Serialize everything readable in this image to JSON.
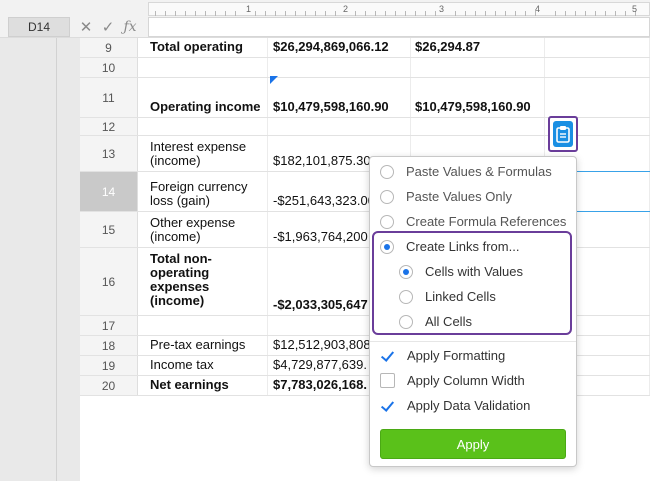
{
  "formula_bar": {
    "cell_ref": "D14",
    "cancel_icon": "✕",
    "confirm_icon": "✓",
    "fx_icon": "ƒx"
  },
  "ruler": {
    "numbers": [
      "1",
      "2",
      "3",
      "4",
      "5"
    ]
  },
  "rows": [
    {
      "num": "9",
      "label": "Total operating",
      "val1": "$26,294,869,066.12",
      "val2": "$26,294.87",
      "bold": true
    },
    {
      "num": "10",
      "label": "",
      "val1": "",
      "val2": ""
    },
    {
      "num": "11",
      "label": "Operating income",
      "val1": "$10,479,598,160.90",
      "val2": "$10,479,598,160.90",
      "bold": true
    },
    {
      "num": "12",
      "label": "",
      "val1": "",
      "val2": ""
    },
    {
      "num": "13",
      "label": "Interest expense (income)",
      "val1": "$182,101,875.30",
      "val2": ""
    },
    {
      "num": "14",
      "label": "Foreign currency loss (gain)",
      "val1": "-$251,643,323.00",
      "val2": "",
      "active": true
    },
    {
      "num": "15",
      "label": "Other expense (income)",
      "val1": "-$1,963,764,200",
      "val2": ""
    },
    {
      "num": "16",
      "label": "Total non-operating expenses (income)",
      "val1": "-$2,033,305,647",
      "val2": "",
      "bold": true
    },
    {
      "num": "17",
      "label": "",
      "val1": "",
      "val2": ""
    },
    {
      "num": "18",
      "label": "Pre-tax earnings",
      "val1": "$12,512,903,808",
      "val2": ""
    },
    {
      "num": "19",
      "label": "Income tax",
      "val1": "$4,729,877,639.",
      "val2": ""
    },
    {
      "num": "20",
      "label": "Net earnings",
      "val1": "$7,783,026,168.",
      "val2": "",
      "bold": true
    }
  ],
  "paste_menu": {
    "options": [
      {
        "label": "Paste Values & Formulas",
        "type": "radio",
        "selected": false
      },
      {
        "label": "Paste Values Only",
        "type": "radio",
        "selected": false
      },
      {
        "label": "Create Formula References",
        "type": "radio",
        "selected": false
      },
      {
        "label": "Create Links from...",
        "type": "radio",
        "selected": true
      },
      {
        "label": "Cells with Values",
        "type": "radio",
        "selected": true
      },
      {
        "label": "Linked Cells",
        "type": "radio",
        "selected": false
      },
      {
        "label": "All Cells",
        "type": "radio",
        "selected": false
      }
    ],
    "checkboxes": [
      {
        "label": "Apply Formatting",
        "checked": true
      },
      {
        "label": "Apply Column Width",
        "checked": false
      },
      {
        "label": "Apply Data Validation",
        "checked": true
      }
    ],
    "apply_label": "Apply"
  },
  "icons": {
    "paste_options": "clipboard-icon"
  },
  "colors": {
    "accent_blue": "#1a73e8",
    "highlight_purple": "#6a3d9a",
    "apply_green": "#5ac11a",
    "paste_blue": "#1a8fe3"
  }
}
